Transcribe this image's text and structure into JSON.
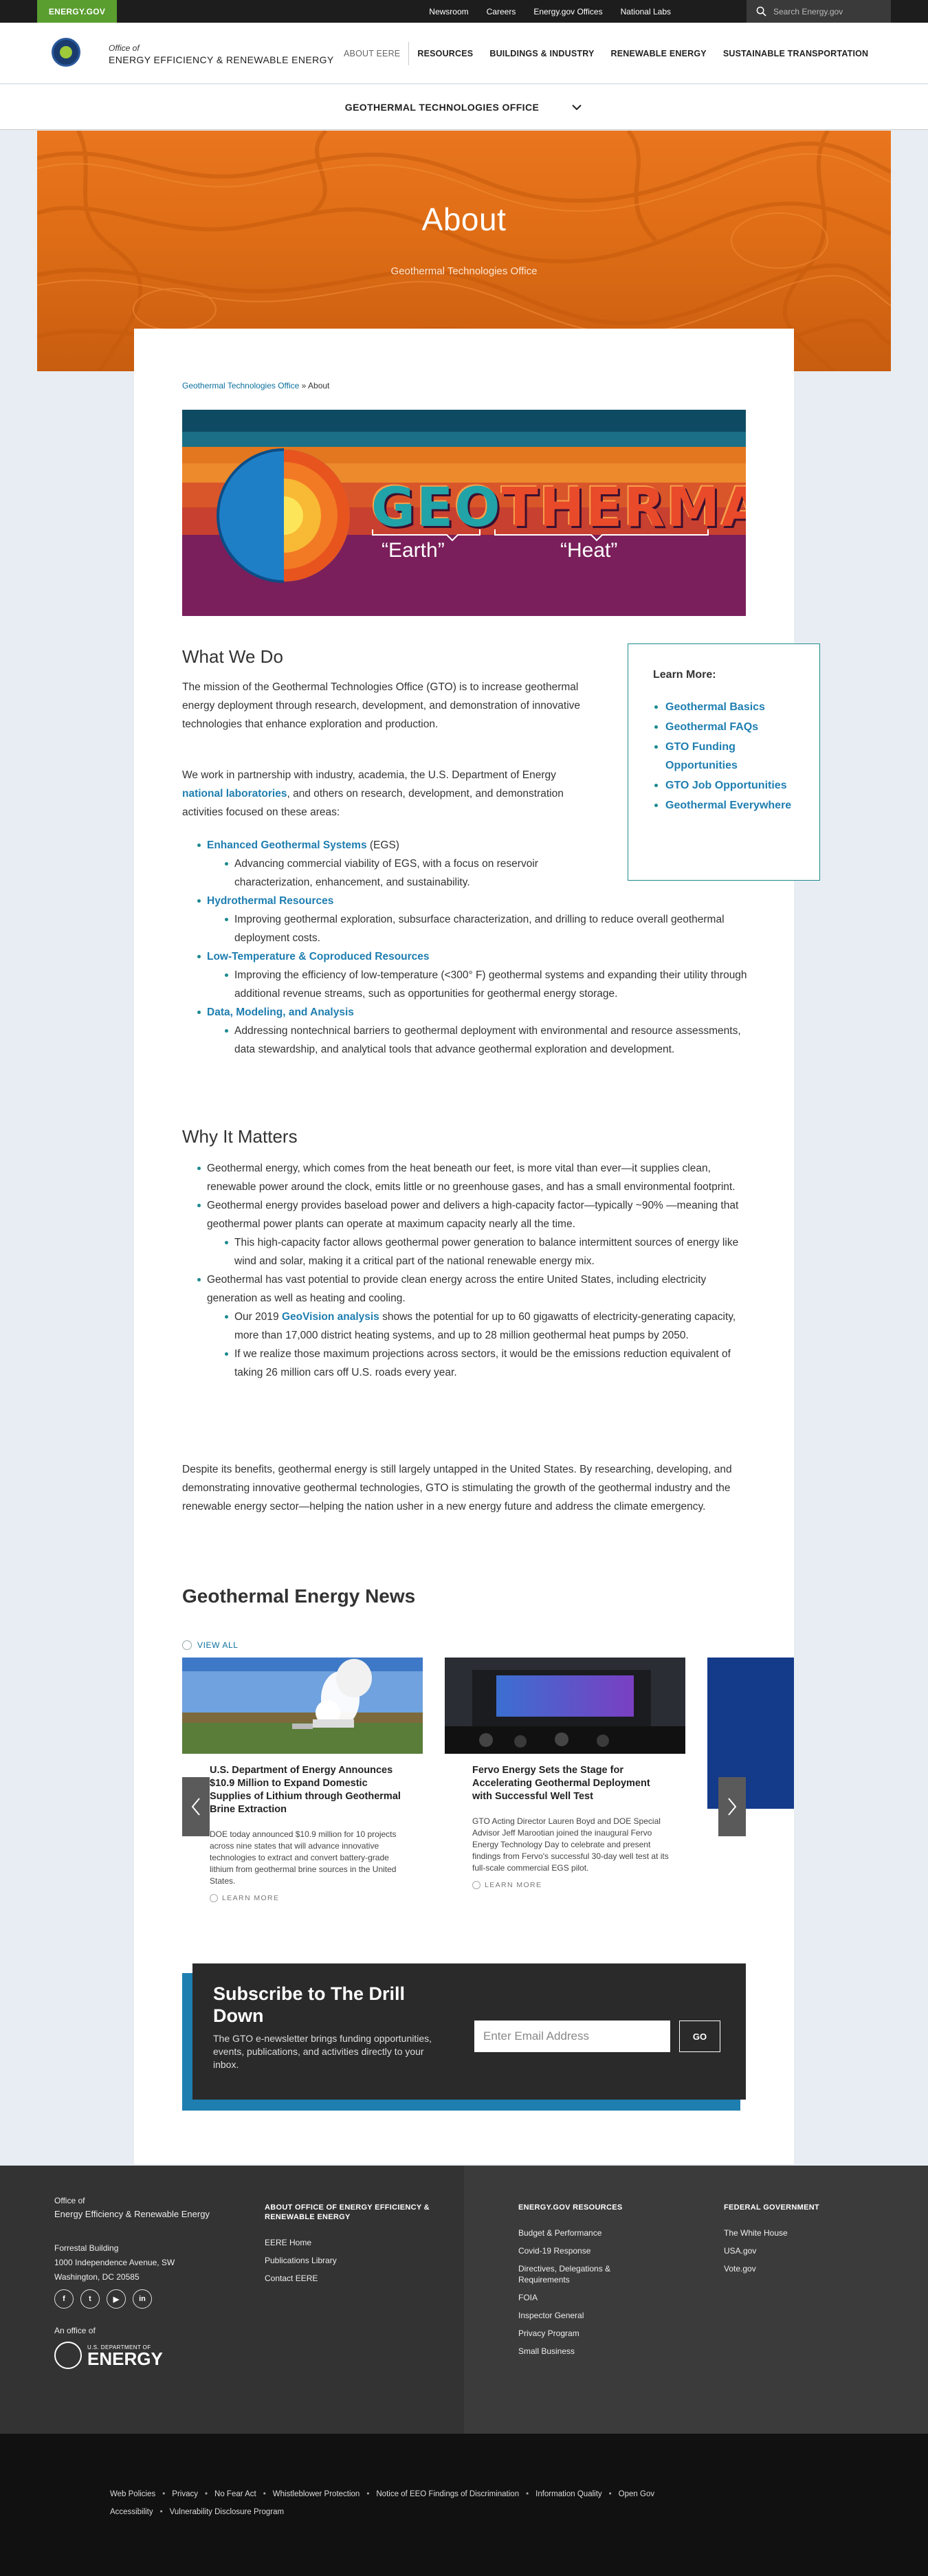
{
  "utility": {
    "logo": "ENERGY.GOV",
    "links": [
      "Newsroom",
      "Careers",
      "Energy.gov Offices",
      "National Labs"
    ],
    "search_placeholder": "Search Energy.gov"
  },
  "header": {
    "office_of": "Office of",
    "office_name": "ENERGY EFFICIENCY & RENEWABLE ENERGY",
    "nav": [
      "ABOUT EERE",
      "RESOURCES",
      "BUILDINGS & INDUSTRY",
      "RENEWABLE ENERGY",
      "SUSTAINABLE TRANSPORTATION"
    ]
  },
  "office_bar": {
    "label": "GEOTHERMAL TECHNOLOGIES OFFICE"
  },
  "hero": {
    "title": "About",
    "subtitle": "Geothermal Technologies Office"
  },
  "breadcrumb": {
    "parent": "Geothermal Technologies Office",
    "separator": " » ",
    "current": "About"
  },
  "banner": {
    "word_geo": "GEO",
    "word_thermal": "THERMAL",
    "caption_earth": "“Earth”",
    "caption_heat": "“Heat”"
  },
  "learn_more": {
    "title": "Learn More:",
    "items": [
      "Geothermal Basics",
      "Geothermal FAQs",
      "GTO Funding Opportunities",
      "GTO Job Opportunities",
      "Geothermal Everywhere"
    ]
  },
  "what_we_do": {
    "heading": "What We Do",
    "p1": "The mission of the Geothermal Technologies Office (GTO) is to increase geothermal energy deployment through research, development, and demonstration of innovative technologies that enhance exploration and production.",
    "p2_a": "We work in partnership with industry, academia, the U.S. Department of Energy ",
    "p2_link": "national laboratories",
    "p2_b": ", and others on research, development, and demonstration activities focused on these areas:",
    "areas": [
      {
        "title": "Enhanced Geothermal Systems",
        "suffix": " (EGS)",
        "detail": "Advancing commercial viability of EGS, with a focus on reservoir characterization, enhancement, and sustainability."
      },
      {
        "title": "Hydrothermal Resources",
        "suffix": "",
        "detail": "Improving geothermal exploration, subsurface characterization, and drilling to reduce overall geothermal deployment costs."
      },
      {
        "title": "Low-Temperature & Coproduced Resources",
        "suffix": "",
        "detail": "Improving the efficiency of low-temperature (<300° F) geothermal systems and expanding their utility through additional revenue streams, such as opportunities for geothermal energy storage."
      },
      {
        "title": "Data, Modeling, and Analysis",
        "suffix": "",
        "detail": "Addressing nontechnical barriers to geothermal deployment with environmental and resource assessments, data stewardship, and analytical tools that advance geothermal exploration and development."
      }
    ]
  },
  "why_it_matters": {
    "heading": "Why It Matters",
    "b1": "Geothermal energy, which comes from the heat beneath our feet, is more vital than ever—it supplies clean, renewable power around the clock, emits little or no greenhouse gases, and has a small environmental footprint.",
    "b2": "Geothermal energy provides baseload power and delivers a high-capacity factor—typically ~90% —meaning that geothermal power plants can operate at maximum capacity nearly all the time.",
    "b2_sub": "This high-capacity factor allows geothermal power generation to balance intermittent sources of energy like wind and solar, making it a critical part of the national renewable energy mix.",
    "b3": "Geothermal has vast potential to provide clean energy across the entire United States, including electricity generation as well as heating and cooling.",
    "b3_sub1_a": "Our 2019 ",
    "b3_sub1_link": "GeoVision analysis",
    "b3_sub1_b": " shows the potential for up to 60 gigawatts of electricity-generating capacity, more than 17,000 district heating systems, and up to 28 million geothermal heat pumps by 2050.",
    "b3_sub2": "If we realize those maximum projections across sectors, it would be the emissions reduction equivalent of taking 26 million cars off U.S. roads every year.",
    "closing": "Despite its benefits, geothermal energy is still largely untapped in the United States. By researching, developing, and demonstrating innovative geothermal technologies, GTO is stimulating the growth of the geothermal industry and the renewable energy sector—helping the nation usher in a new energy future and address the climate emergency."
  },
  "news": {
    "heading": "Geothermal Energy News",
    "view_all": "VIEW ALL",
    "read_more": "LEARN MORE",
    "cards": [
      {
        "title": "U.S. Department of Energy Announces $10.9 Million to Expand Domestic Supplies of Lithium through Geothermal Brine Extraction",
        "body": "DOE today announced $10.9 million for 10 projects across nine states that will advance innovative technologies to extract and convert battery-grade lithium from geothermal brine sources in the United States."
      },
      {
        "title": "Fervo Energy Sets the Stage for Accelerating Geothermal Deployment with Successful Well Test",
        "body": "GTO Acting Director Lauren Boyd and DOE Special Advisor Jeff Marootian joined the inaugural Fervo Energy Technology Day to celebrate and present findings from Fervo's successful 30-day well test at its full-scale commercial EGS pilot."
      }
    ]
  },
  "subscribe": {
    "title": "Subscribe to The Drill Down",
    "body": "The GTO e-newsletter brings funding opportunities, events, publications, and activities directly to your inbox.",
    "placeholder": "Enter Email Address",
    "button": "GO"
  },
  "footer": {
    "office_of": "Office of",
    "office_name": "Energy Efficiency & Renewable Energy",
    "address": [
      "Forrestal Building",
      "1000 Independence Avenue, SW",
      "Washington, DC 20585"
    ],
    "social": [
      "f",
      "t",
      "▶",
      "in"
    ],
    "an_office_of": "An office of",
    "doe_small": "U.S. DEPARTMENT OF",
    "doe_big": "ENERGY",
    "col1_title": "ABOUT OFFICE OF ENERGY EFFICIENCY & RENEWABLE ENERGY",
    "col1": [
      "EERE Home",
      "Publications Library",
      "Contact EERE"
    ],
    "col2_title": "ENERGY.GOV RESOURCES",
    "col2": [
      "Budget & Performance",
      "Covid-19 Response",
      "Directives, Delegations & Requirements",
      "FOIA",
      "Inspector General",
      "Privacy Program",
      "Small Business"
    ],
    "col3_title": "FEDERAL GOVERNMENT",
    "col3": [
      "The White House",
      "USA.gov",
      "Vote.gov"
    ]
  },
  "legal": {
    "row1": [
      "Web Policies",
      "Privacy",
      "No Fear Act",
      "Whistleblower Protection",
      "Notice of EEO Findings of Discrimination",
      "Information Quality",
      "Open Gov"
    ],
    "row2": [
      "Accessibility",
      "Vulnerability Disclosure Program"
    ]
  },
  "colors": {
    "brand_green": "#5a9e2f",
    "link_blue": "#1e7eb0",
    "teal": "#1c8a8f",
    "hero_orange": "#e06e16"
  }
}
